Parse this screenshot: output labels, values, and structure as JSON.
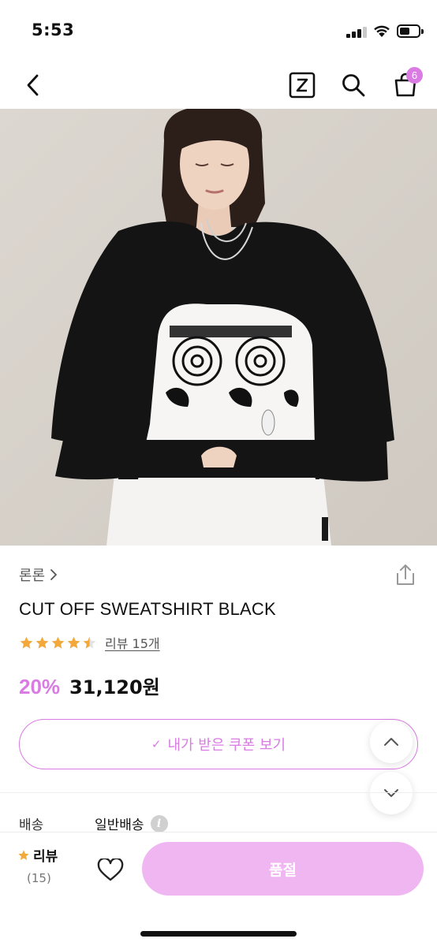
{
  "status_bar": {
    "time": "5:53"
  },
  "nav": {
    "back_icon": "chevron-left-icon",
    "z_label": "Z",
    "cart_count": "6",
    "colors": {
      "badge": "#d97be3"
    }
  },
  "product": {
    "brand": "론론",
    "brand_chevron": ">",
    "title": "CUT OFF SWEATSHIRT BLACK",
    "rating": 4.5,
    "review_link": "리뷰 15개",
    "discount": "20%",
    "price": "31,120원",
    "coupon_check": "✓",
    "coupon_label": "내가 받은 쿠폰 보기",
    "shipping_label": "배송",
    "shipping_value": "일반배송",
    "shipping_info": "i"
  },
  "bottom_bar": {
    "review_label": "리뷰",
    "review_count": "(15)",
    "soldout_label": "품절"
  },
  "colors": {
    "accent": "#d97be3",
    "star": "#f2a93b",
    "soldout_bg": "#efb6f2"
  }
}
